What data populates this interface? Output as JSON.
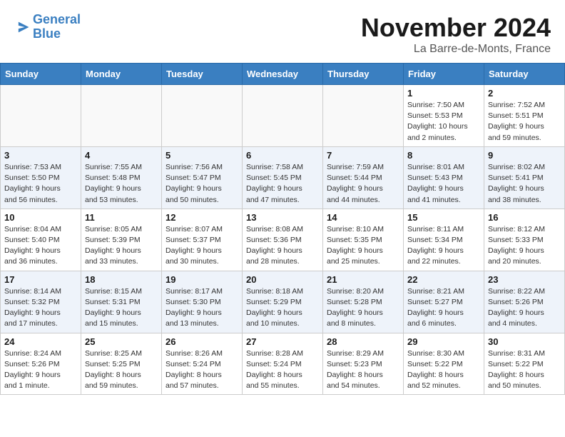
{
  "header": {
    "logo_line1": "General",
    "logo_line2": "Blue",
    "month_title": "November 2024",
    "location": "La Barre-de-Monts, France"
  },
  "weekdays": [
    "Sunday",
    "Monday",
    "Tuesday",
    "Wednesday",
    "Thursday",
    "Friday",
    "Saturday"
  ],
  "weeks": [
    [
      {
        "day": "",
        "info": ""
      },
      {
        "day": "",
        "info": ""
      },
      {
        "day": "",
        "info": ""
      },
      {
        "day": "",
        "info": ""
      },
      {
        "day": "",
        "info": ""
      },
      {
        "day": "1",
        "info": "Sunrise: 7:50 AM\nSunset: 5:53 PM\nDaylight: 10 hours\nand 2 minutes."
      },
      {
        "day": "2",
        "info": "Sunrise: 7:52 AM\nSunset: 5:51 PM\nDaylight: 9 hours\nand 59 minutes."
      }
    ],
    [
      {
        "day": "3",
        "info": "Sunrise: 7:53 AM\nSunset: 5:50 PM\nDaylight: 9 hours\nand 56 minutes."
      },
      {
        "day": "4",
        "info": "Sunrise: 7:55 AM\nSunset: 5:48 PM\nDaylight: 9 hours\nand 53 minutes."
      },
      {
        "day": "5",
        "info": "Sunrise: 7:56 AM\nSunset: 5:47 PM\nDaylight: 9 hours\nand 50 minutes."
      },
      {
        "day": "6",
        "info": "Sunrise: 7:58 AM\nSunset: 5:45 PM\nDaylight: 9 hours\nand 47 minutes."
      },
      {
        "day": "7",
        "info": "Sunrise: 7:59 AM\nSunset: 5:44 PM\nDaylight: 9 hours\nand 44 minutes."
      },
      {
        "day": "8",
        "info": "Sunrise: 8:01 AM\nSunset: 5:43 PM\nDaylight: 9 hours\nand 41 minutes."
      },
      {
        "day": "9",
        "info": "Sunrise: 8:02 AM\nSunset: 5:41 PM\nDaylight: 9 hours\nand 38 minutes."
      }
    ],
    [
      {
        "day": "10",
        "info": "Sunrise: 8:04 AM\nSunset: 5:40 PM\nDaylight: 9 hours\nand 36 minutes."
      },
      {
        "day": "11",
        "info": "Sunrise: 8:05 AM\nSunset: 5:39 PM\nDaylight: 9 hours\nand 33 minutes."
      },
      {
        "day": "12",
        "info": "Sunrise: 8:07 AM\nSunset: 5:37 PM\nDaylight: 9 hours\nand 30 minutes."
      },
      {
        "day": "13",
        "info": "Sunrise: 8:08 AM\nSunset: 5:36 PM\nDaylight: 9 hours\nand 28 minutes."
      },
      {
        "day": "14",
        "info": "Sunrise: 8:10 AM\nSunset: 5:35 PM\nDaylight: 9 hours\nand 25 minutes."
      },
      {
        "day": "15",
        "info": "Sunrise: 8:11 AM\nSunset: 5:34 PM\nDaylight: 9 hours\nand 22 minutes."
      },
      {
        "day": "16",
        "info": "Sunrise: 8:12 AM\nSunset: 5:33 PM\nDaylight: 9 hours\nand 20 minutes."
      }
    ],
    [
      {
        "day": "17",
        "info": "Sunrise: 8:14 AM\nSunset: 5:32 PM\nDaylight: 9 hours\nand 17 minutes."
      },
      {
        "day": "18",
        "info": "Sunrise: 8:15 AM\nSunset: 5:31 PM\nDaylight: 9 hours\nand 15 minutes."
      },
      {
        "day": "19",
        "info": "Sunrise: 8:17 AM\nSunset: 5:30 PM\nDaylight: 9 hours\nand 13 minutes."
      },
      {
        "day": "20",
        "info": "Sunrise: 8:18 AM\nSunset: 5:29 PM\nDaylight: 9 hours\nand 10 minutes."
      },
      {
        "day": "21",
        "info": "Sunrise: 8:20 AM\nSunset: 5:28 PM\nDaylight: 9 hours\nand 8 minutes."
      },
      {
        "day": "22",
        "info": "Sunrise: 8:21 AM\nSunset: 5:27 PM\nDaylight: 9 hours\nand 6 minutes."
      },
      {
        "day": "23",
        "info": "Sunrise: 8:22 AM\nSunset: 5:26 PM\nDaylight: 9 hours\nand 4 minutes."
      }
    ],
    [
      {
        "day": "24",
        "info": "Sunrise: 8:24 AM\nSunset: 5:26 PM\nDaylight: 9 hours\nand 1 minute."
      },
      {
        "day": "25",
        "info": "Sunrise: 8:25 AM\nSunset: 5:25 PM\nDaylight: 8 hours\nand 59 minutes."
      },
      {
        "day": "26",
        "info": "Sunrise: 8:26 AM\nSunset: 5:24 PM\nDaylight: 8 hours\nand 57 minutes."
      },
      {
        "day": "27",
        "info": "Sunrise: 8:28 AM\nSunset: 5:24 PM\nDaylight: 8 hours\nand 55 minutes."
      },
      {
        "day": "28",
        "info": "Sunrise: 8:29 AM\nSunset: 5:23 PM\nDaylight: 8 hours\nand 54 minutes."
      },
      {
        "day": "29",
        "info": "Sunrise: 8:30 AM\nSunset: 5:22 PM\nDaylight: 8 hours\nand 52 minutes."
      },
      {
        "day": "30",
        "info": "Sunrise: 8:31 AM\nSunset: 5:22 PM\nDaylight: 8 hours\nand 50 minutes."
      }
    ]
  ]
}
